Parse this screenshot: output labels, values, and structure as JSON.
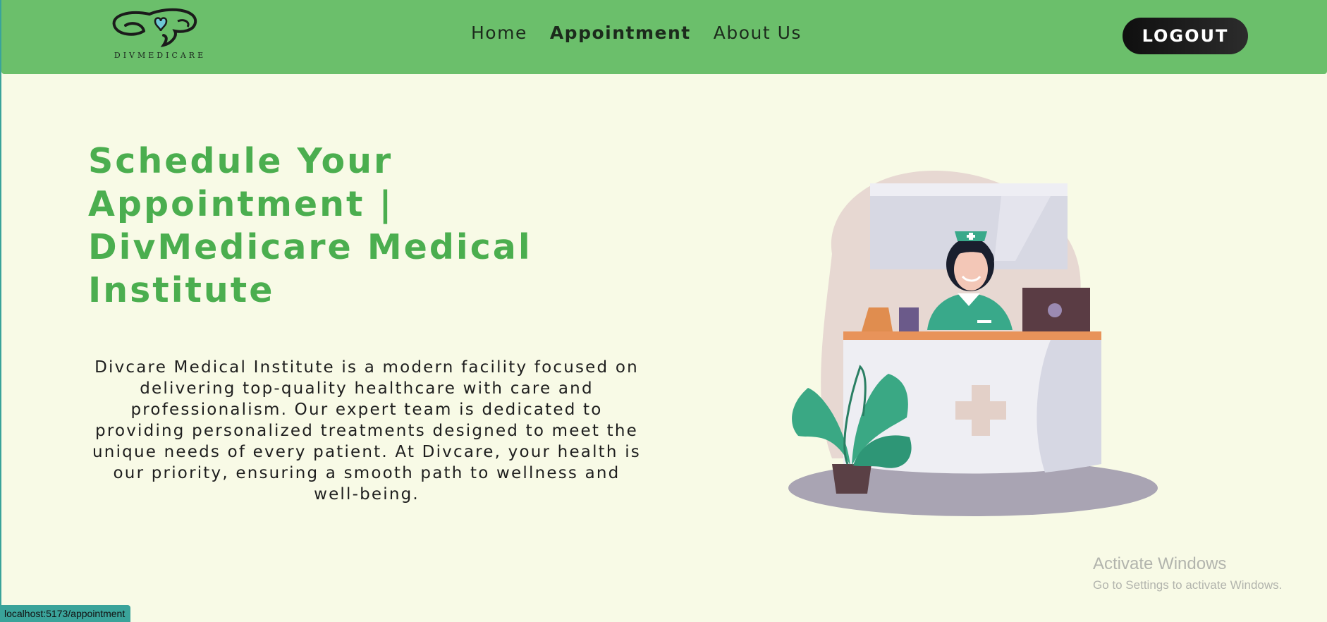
{
  "header": {
    "logo_text": "DIVMEDICARE",
    "nav": [
      {
        "label": "Home"
      },
      {
        "label": "Appointment"
      },
      {
        "label": "About Us"
      }
    ],
    "logout_label": "LOGOUT"
  },
  "hero": {
    "title": "Schedule Your Appointment | DivMedicare Medical Institute",
    "description": "Divcare Medical Institute is a modern facility focused on delivering top-quality healthcare with care and professionalism. Our expert team is dedicated to providing personalized treatments designed to meet the unique needs of every patient. At Divcare, your health is our priority, ensuring a smooth path to wellness and well-being."
  },
  "windows_notice": {
    "line1": "Activate Windows",
    "line2": "Go to Settings to activate Windows."
  },
  "status_bar": {
    "url": "localhost:5173/appointment"
  },
  "colors": {
    "header_bg": "#6bbf6b",
    "page_bg": "#f8fae6",
    "title_green": "#4bae4f",
    "logout_bg": "#111111"
  }
}
